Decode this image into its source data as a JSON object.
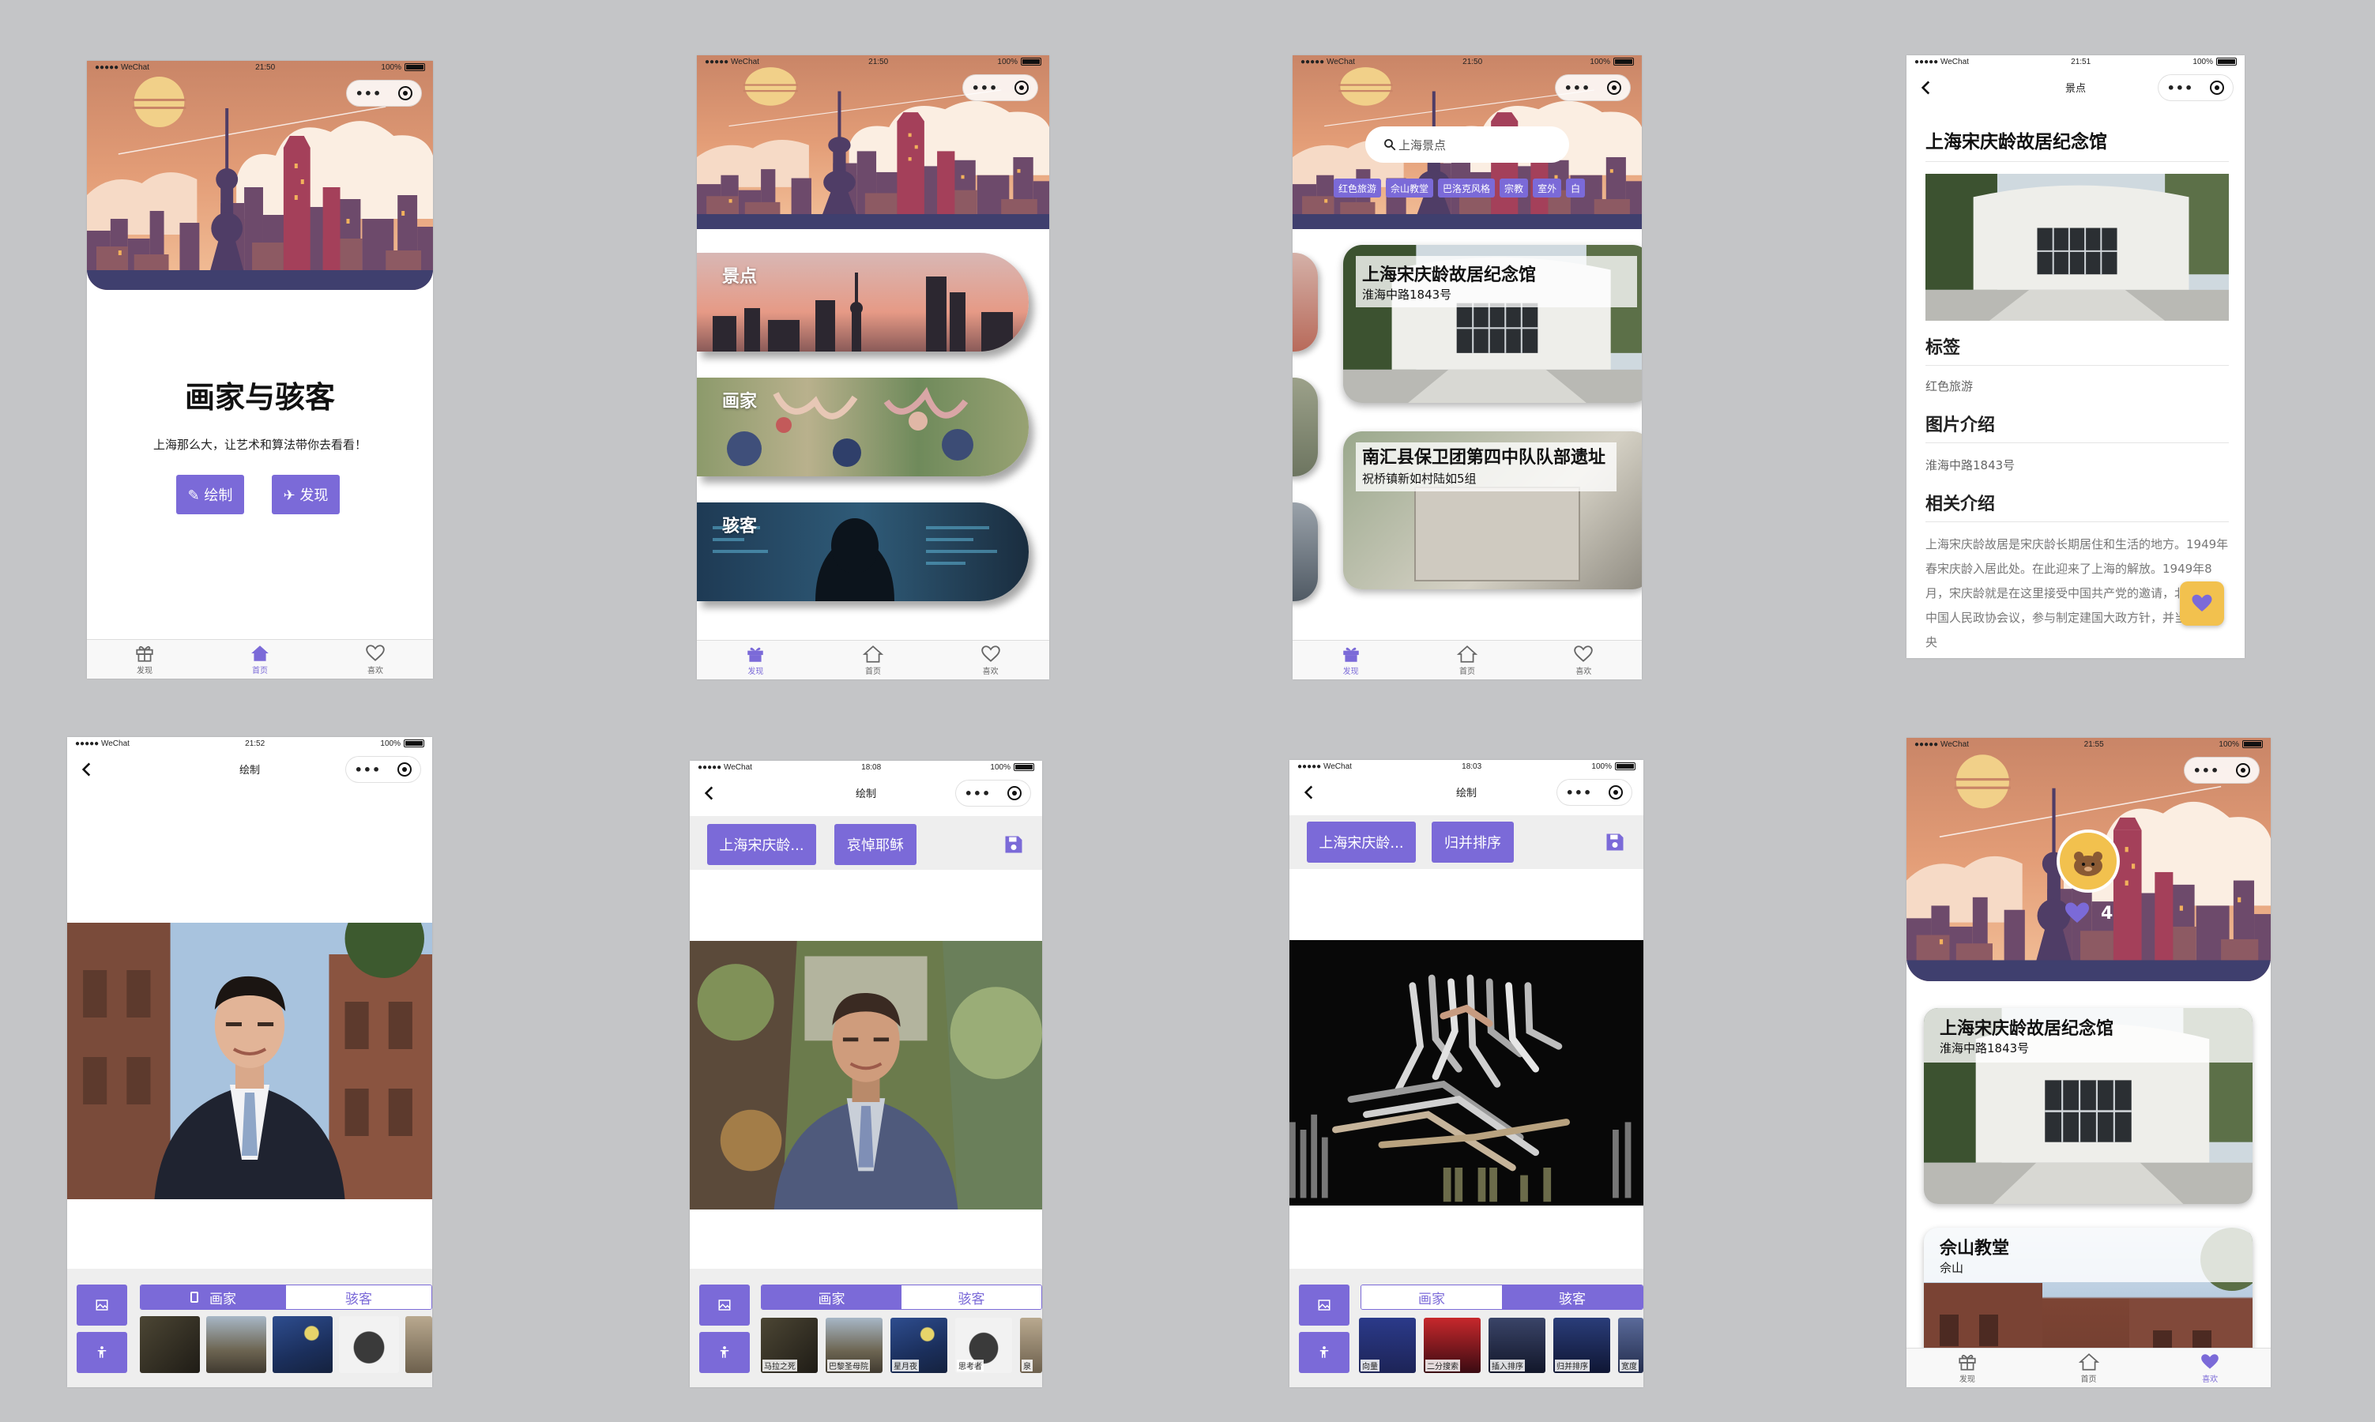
{
  "status_bar": {
    "carrier": "●●●●● WeChat",
    "battery": "100%",
    "times": [
      "21:50",
      "21:50",
      "21:50",
      "21:51",
      "21:52",
      "18:08",
      "18:03",
      "21:55"
    ]
  },
  "tabbar": {
    "discover": "发现",
    "home": "首页",
    "like": "喜欢"
  },
  "screen1": {
    "title": "画家与骇客",
    "subtitle": "上海那么大，让艺术和算法带你去看看！",
    "draw_button": "✎ 绘制",
    "discover_button": "✈ 发现"
  },
  "screen2": {
    "cards": [
      {
        "label": "景点"
      },
      {
        "label": "画家"
      },
      {
        "label": "骇客"
      }
    ]
  },
  "screen3": {
    "search_placeholder": "上海景点",
    "tags": [
      "红色旅游",
      "佘山教堂",
      "巴洛克风格",
      "宗教",
      "室外",
      "白"
    ],
    "cards": [
      {
        "title": "上海宋庆龄故居纪念馆",
        "address": "淮海中路1843号"
      },
      {
        "title": "南汇县保卫团第四中队队部遗址",
        "address": "祝桥镇新如村陆如5组"
      }
    ]
  },
  "screen4": {
    "nav_title": "景点",
    "title": "上海宋庆龄故居纪念馆",
    "tag_heading": "标签",
    "tag_value": "红色旅游",
    "image_heading": "图片介绍",
    "image_value": "淮海中路1843号",
    "intro_heading": "相关介绍",
    "intro_text": "上海宋庆龄故居是宋庆龄长期居住和生活的地方。1949年春宋庆龄入居此处。在此迎来了上海的解放。1949年8月，宋庆龄就是在这里接受中国共产党的邀请，北上出席中国人民政协会议，参与制定建国大政方针，并当选为中央"
  },
  "screen5": {
    "nav_title": "绘制",
    "seg_left": "画家",
    "seg_right": "骇客"
  },
  "screen6": {
    "nav_title": "绘制",
    "btn_place": "上海宋庆龄...",
    "btn_style": "哀悼耶稣",
    "seg_left": "画家",
    "seg_right": "骇客",
    "thumb_labels": [
      "马拉之死",
      "巴黎圣母院",
      "星月夜",
      "思考者",
      "泉"
    ]
  },
  "screen7": {
    "nav_title": "绘制",
    "btn_place": "上海宋庆龄...",
    "btn_style": "归并排序",
    "seg_left": "画家",
    "seg_right": "骇客",
    "thumb_labels": [
      "向量",
      "二分搜索",
      "插入排序",
      "归并排序",
      "宽度"
    ]
  },
  "screen8": {
    "like_count": "4",
    "cards": [
      {
        "title": "上海宋庆龄故居纪念馆",
        "address": "淮海中路1843号"
      },
      {
        "title": "佘山教堂",
        "address": "佘山"
      }
    ]
  },
  "colors": {
    "accent": "#7b6ad8",
    "bg": "#c4c5c7",
    "fab": "#f2c14e"
  }
}
